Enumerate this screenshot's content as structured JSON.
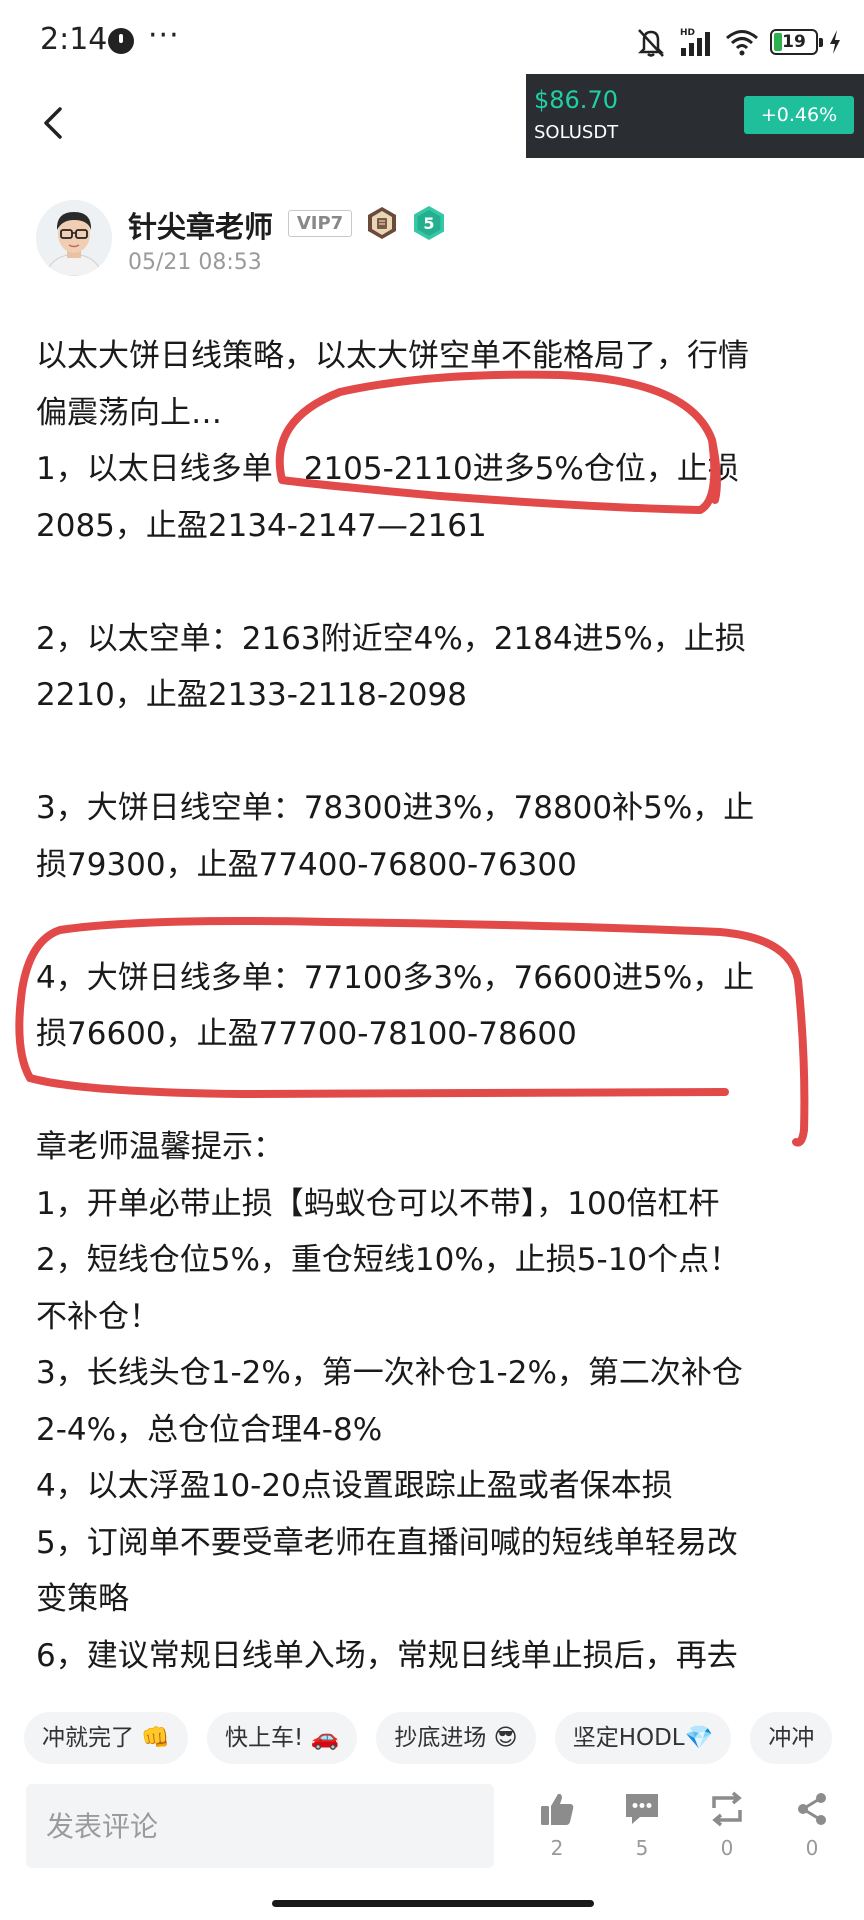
{
  "status_bar": {
    "time": "2:14",
    "more": "···",
    "network": "HD",
    "battery": "19"
  },
  "ticker": {
    "price": "$86.70",
    "symbol": "SOLUSDT",
    "change": "+0.46%",
    "price_color": "#20d0a5",
    "change_bg": "#1fbf9c"
  },
  "author": {
    "name": "针尖章老师",
    "vip": "VIP7",
    "level": "5",
    "time": "05/21 08:53"
  },
  "post": {
    "lines": [
      "以太大饼日线策略，以太大饼空单不能格局了，行情",
      "偏震荡向上…",
      "1，以太日线多单：2105-2110进多5%仓位，止损",
      "2085，止盈2134-2147—2161",
      "",
      "2，以太空单：2163附近空4%，2184进5%，止损",
      "2210，止盈2133-2118-2098",
      "",
      "3，大饼日线空单：78300进3%，78800补5%，止",
      "损79300，止盈77400-76800-76300",
      "",
      "4，大饼日线多单：77100多3%，76600进5%，止",
      "损76600，止盈77700-78100-78600",
      "",
      "章老师温馨提示：",
      "1，开单必带止损【蚂蚁仓可以不带】，100倍杠杆",
      "2，短线仓位5%，重仓短线10%，止损5-10个点！",
      "不补仓！",
      "3，长线头仓1-2%，第一次补仓1-2%，第二次补仓",
      "2-4%，总仓位合理4-8%",
      "4，以太浮盈10-20点设置跟踪止盈或者保本损",
      "5，订阅单不要受章老师在直播间喊的短线单轻易改",
      "变策略",
      "6，建议常规日线单入场，常规日线单止损后，再去"
    ],
    "annotation_color": "#e24a4a"
  },
  "tags": [
    "冲就完了 👊",
    "快上车! 🚗",
    "抄底进场 😎",
    "坚定HODL💎",
    "冲冲"
  ],
  "bottom_bar": {
    "comment_placeholder": "发表评论",
    "likes": "2",
    "comments": "5",
    "reposts": "0",
    "shares": "0"
  }
}
